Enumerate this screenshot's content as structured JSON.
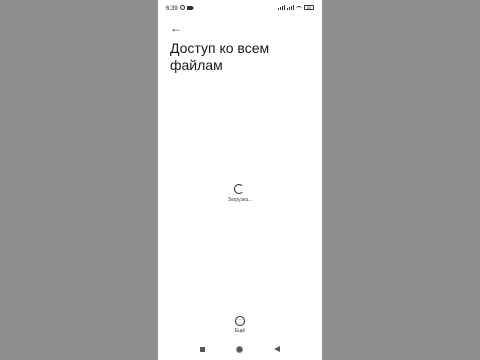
{
  "status_bar": {
    "time": "6:39",
    "battery": "55",
    "icons": [
      "alarm-icon",
      "video-icon",
      "signal-icon",
      "signal-icon",
      "wifi-icon",
      "battery-icon"
    ]
  },
  "header": {
    "back_icon": "arrow-left",
    "title": "Доступ ко всем файлам"
  },
  "loader": {
    "text": "Загрузка..."
  },
  "bottom_action": {
    "icon": "more-icon",
    "label": "Ещё"
  },
  "nav_bar": {
    "icons": [
      "recents-icon",
      "home-icon",
      "back-icon"
    ]
  },
  "colors": {
    "background": "#8f8f8f",
    "screen": "#ffffff",
    "text": "#1a1a1a"
  }
}
